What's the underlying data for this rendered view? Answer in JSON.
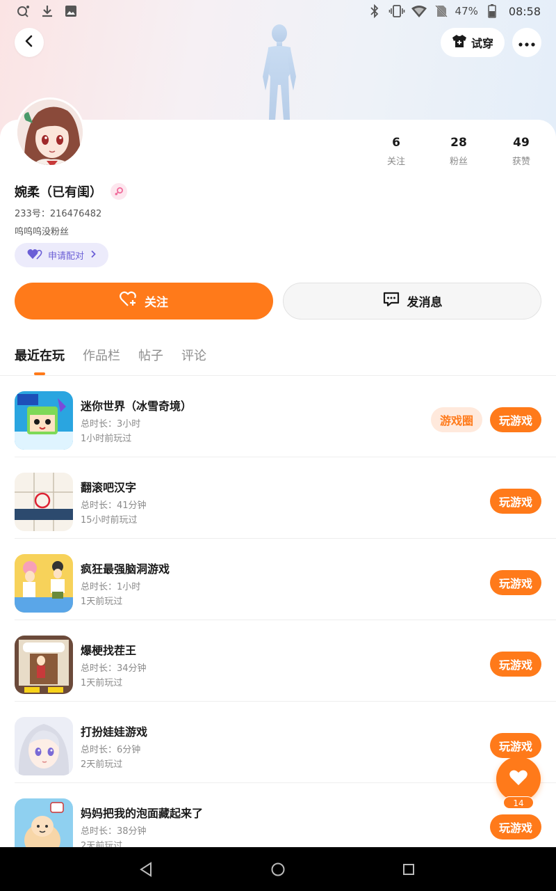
{
  "status_bar": {
    "battery": "47%",
    "time": "08:58",
    "left_icons": [
      "search-key-icon",
      "download-icon",
      "image-icon"
    ],
    "right_icons": [
      "bluetooth-icon",
      "vibrate-icon",
      "wifi-icon",
      "no-sim-icon",
      "battery-icon"
    ]
  },
  "header": {
    "tryon_label": "试穿"
  },
  "profile": {
    "name": "婉柔（已有闺）",
    "uid": "233号：216476482",
    "bio": "呜呜呜没粉丝",
    "match_label": "申请配对",
    "stats": [
      {
        "value": "6",
        "label": "关注"
      },
      {
        "value": "28",
        "label": "粉丝"
      },
      {
        "value": "49",
        "label": "获赞"
      }
    ]
  },
  "actions": {
    "follow_label": "关注",
    "message_label": "发消息"
  },
  "tabs": [
    {
      "label": "最近在玩",
      "active": true
    },
    {
      "label": "作品栏",
      "active": false
    },
    {
      "label": "帖子",
      "active": false
    },
    {
      "label": "评论",
      "active": false
    }
  ],
  "games": [
    {
      "title": "迷你世界（冰雪奇境）",
      "duration": "总时长：3小时",
      "last_played": "1小时前玩过",
      "circle_label": "游戏圈",
      "play_label": "玩游戏"
    },
    {
      "title": "翻滚吧汉字",
      "duration": "总时长：41分钟",
      "last_played": "15小时前玩过",
      "play_label": "玩游戏"
    },
    {
      "title": "疯狂最强脑洞游戏",
      "duration": "总时长：1小时",
      "last_played": "1天前玩过",
      "play_label": "玩游戏"
    },
    {
      "title": "爆梗找茬王",
      "duration": "总时长：34分钟",
      "last_played": "1天前玩过",
      "play_label": "玩游戏"
    },
    {
      "title": "打扮娃娃游戏",
      "duration": "总时长：6分钟",
      "last_played": "2天前玩过",
      "play_label": "玩游戏"
    },
    {
      "title": "妈妈把我的泡面藏起来了",
      "duration": "总时长：38分钟",
      "last_played": "2天前玩过",
      "play_label": "玩游戏"
    }
  ],
  "like_fab": {
    "count": "14"
  },
  "colors": {
    "accent": "#ff7a1a",
    "match_purple": "#6b5fd6"
  }
}
